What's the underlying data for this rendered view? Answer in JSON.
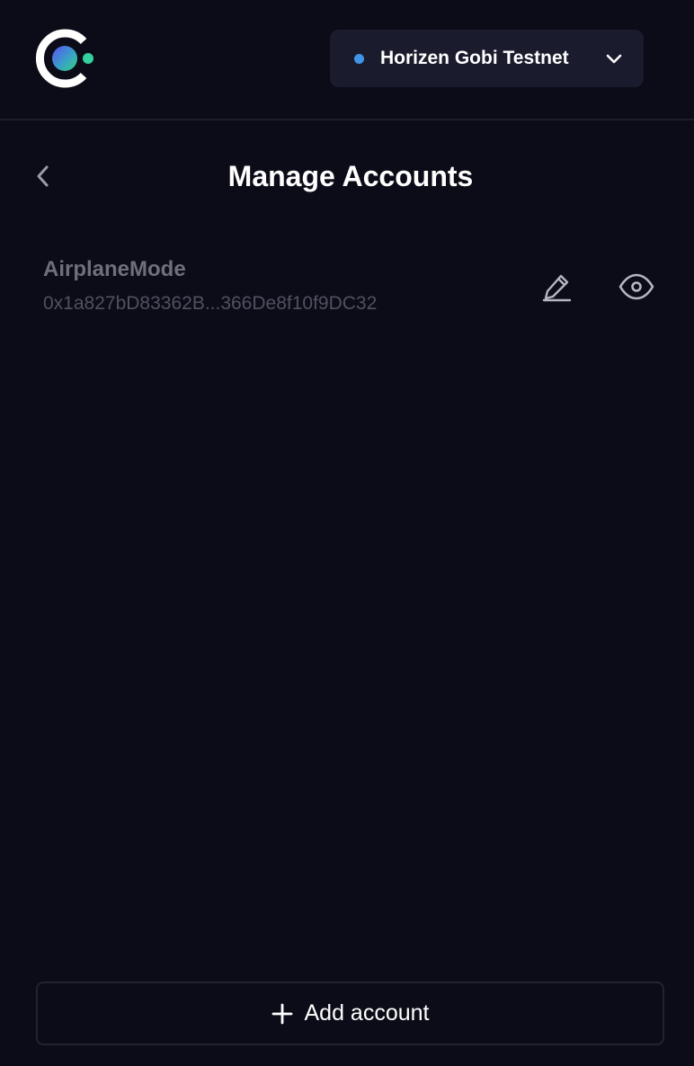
{
  "header": {
    "logo_icon": "celo-logo-icon",
    "network": {
      "name": "Horizen Gobi Testnet",
      "status_color": "#3e95e8",
      "icon": "chevron-down-icon"
    }
  },
  "page": {
    "back_icon": "chevron-left-icon",
    "title": "Manage Accounts"
  },
  "accounts": [
    {
      "name": "AirplaneMode",
      "address": "0x1a827bD83362B...366De8f10f9DC32",
      "edit_icon": "pencil-icon",
      "view_icon": "eye-icon"
    }
  ],
  "footer": {
    "add_icon": "plus-icon",
    "add_label": "Add account"
  },
  "colors": {
    "background": "#0c0c18",
    "selector_background": "#1a1b2c",
    "muted_text": "#6e6f7b",
    "logo_gradient_start": "#5a4ff0",
    "logo_gradient_end": "#35d07f"
  }
}
